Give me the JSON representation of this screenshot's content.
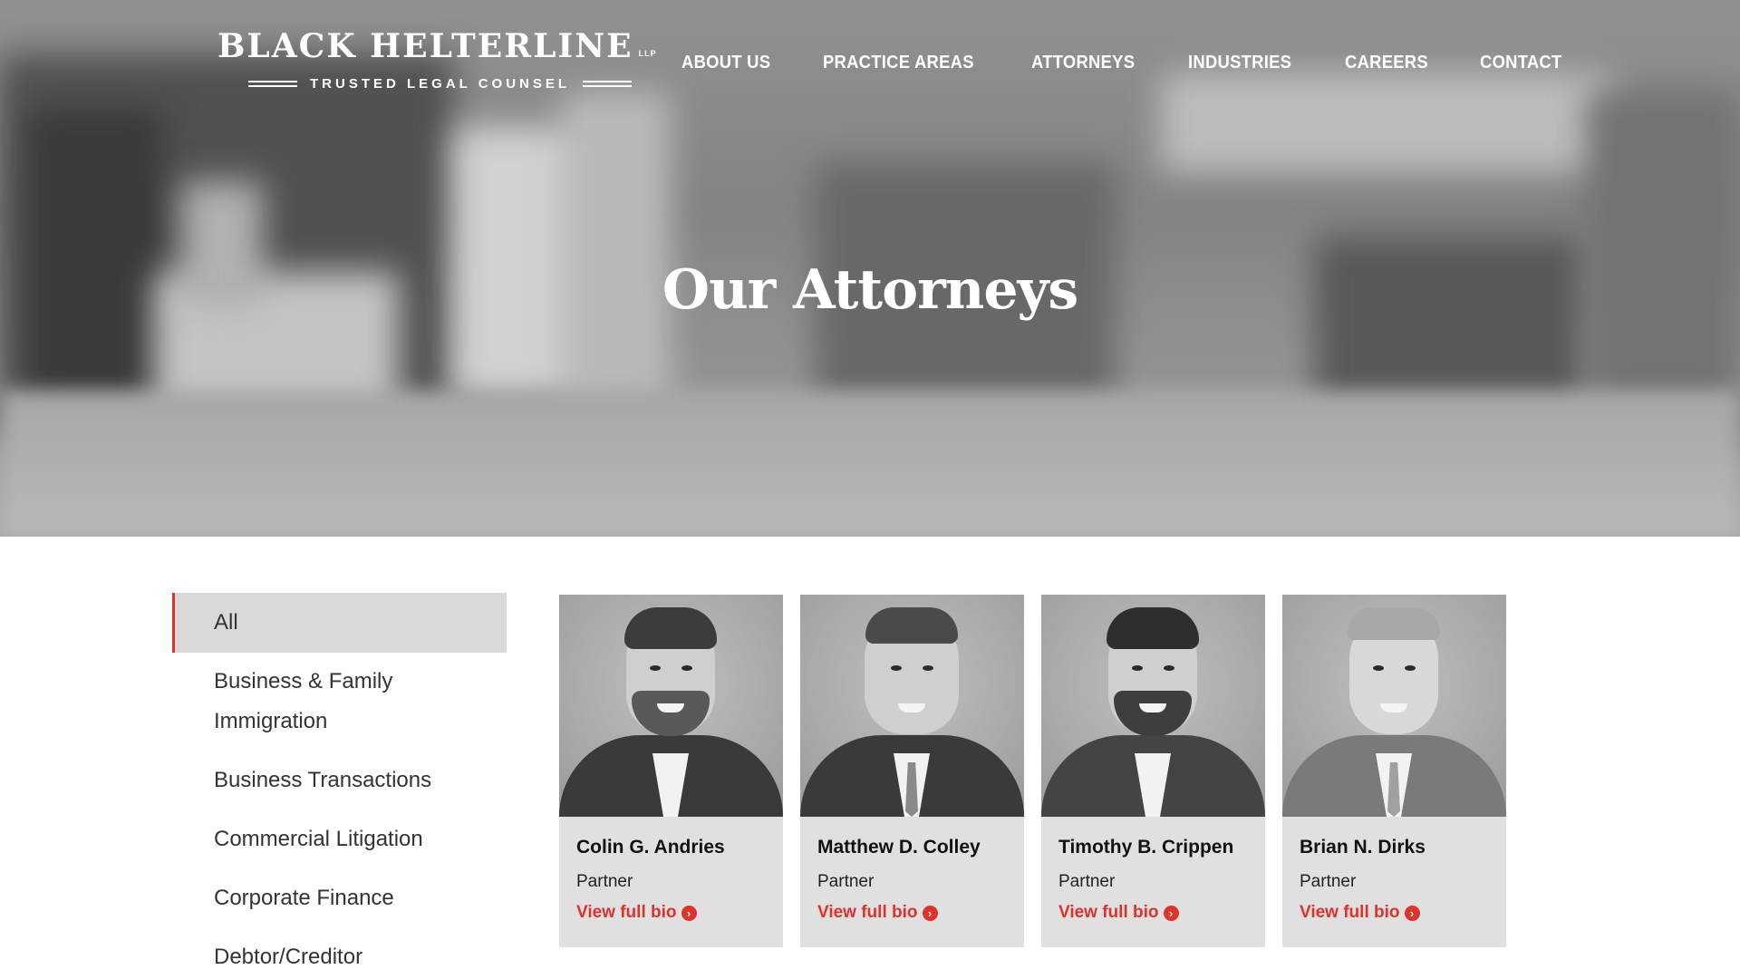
{
  "brand": {
    "name": "BLACK HELTERLINE",
    "suffix": "LLP",
    "tagline": "TRUSTED LEGAL COUNSEL"
  },
  "nav": {
    "items": [
      {
        "label": "ABOUT US"
      },
      {
        "label": "PRACTICE AREAS"
      },
      {
        "label": "ATTORNEYS"
      },
      {
        "label": "INDUSTRIES"
      },
      {
        "label": "CAREERS"
      },
      {
        "label": "CONTACT"
      }
    ]
  },
  "hero": {
    "title": "Our Attorneys"
  },
  "filters": {
    "items": [
      {
        "label": "All",
        "active": true
      },
      {
        "label": "Business & Family Immigration"
      },
      {
        "label": "Business Transactions"
      },
      {
        "label": "Commercial Litigation"
      },
      {
        "label": "Corporate Finance"
      },
      {
        "label": "Debtor/Creditor"
      }
    ]
  },
  "attorneys": [
    {
      "name": "Colin G. Andries",
      "role": "Partner",
      "link": "View full bio"
    },
    {
      "name": "Matthew D. Colley",
      "role": "Partner",
      "link": "View full bio"
    },
    {
      "name": "Timothy B. Crippen",
      "role": "Partner",
      "link": "View full bio"
    },
    {
      "name": "Brian N. Dirks",
      "role": "Partner",
      "link": "View full bio"
    }
  ],
  "icons": {
    "bio_link": "arrow-circle-right-icon"
  },
  "colors": {
    "accent": "#e0312b",
    "card_bg": "#e0e0e0",
    "active_filter_bg": "#d9d9d9"
  }
}
